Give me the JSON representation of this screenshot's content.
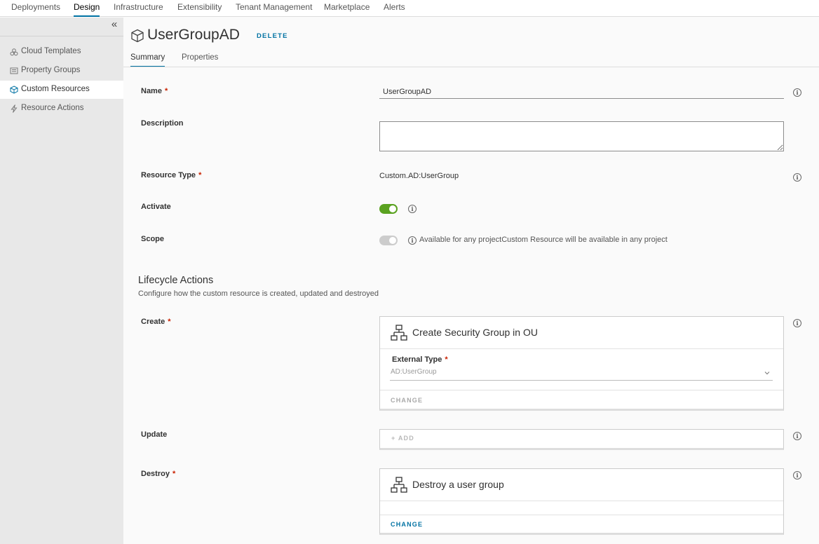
{
  "nav": {
    "tabs": [
      {
        "label": "Deployments"
      },
      {
        "label": "Design"
      },
      {
        "label": "Infrastructure"
      },
      {
        "label": "Extensibility"
      },
      {
        "label": "Tenant Management"
      },
      {
        "label": "Marketplace"
      },
      {
        "label": "Alerts"
      }
    ],
    "active_tab": "Design"
  },
  "sidebar": {
    "collapse_icon": "double-chevron-left-icon",
    "items": [
      {
        "label": "Cloud Templates",
        "icon": "cloud-templates-icon"
      },
      {
        "label": "Property Groups",
        "icon": "property-groups-icon"
      },
      {
        "label": "Custom Resources",
        "icon": "cube-icon"
      },
      {
        "label": "Resource Actions",
        "icon": "lightning-icon"
      }
    ],
    "active_item": "Custom Resources"
  },
  "header": {
    "title": "UserGroupAD",
    "delete_label": "DELETE",
    "tabs": [
      {
        "label": "Summary"
      },
      {
        "label": "Properties"
      }
    ],
    "active_tab": "Summary"
  },
  "form": {
    "name": {
      "label": "Name",
      "required": "*",
      "value": "UserGroupAD"
    },
    "description": {
      "label": "Description",
      "value": ""
    },
    "resource_type": {
      "label": "Resource Type",
      "required": "*",
      "value": "Custom.AD:UserGroup"
    },
    "activate": {
      "label": "Activate",
      "checked": true
    },
    "scope": {
      "label": "Scope",
      "checked": true,
      "disabled": true,
      "help": "Available for any projectCustom Resource will be available in any project"
    }
  },
  "lifecycle": {
    "title": "Lifecycle Actions",
    "subtitle": "Configure how the custom resource is created, updated and destroyed",
    "create": {
      "label": "Create",
      "required": "*",
      "workflow": "Create Security Group in OU",
      "external_type_label": "External Type",
      "external_type_required": "*",
      "external_type_value": "AD:UserGroup",
      "change_label": "CHANGE"
    },
    "update": {
      "label": "Update",
      "add_label": "ADD"
    },
    "destroy": {
      "label": "Destroy",
      "required": "*",
      "workflow": "Destroy a user group",
      "change_label": "CHANGE"
    }
  },
  "colors": {
    "accent": "#0072a3",
    "toggle_on": "#5aa220",
    "required": "#c92100"
  }
}
